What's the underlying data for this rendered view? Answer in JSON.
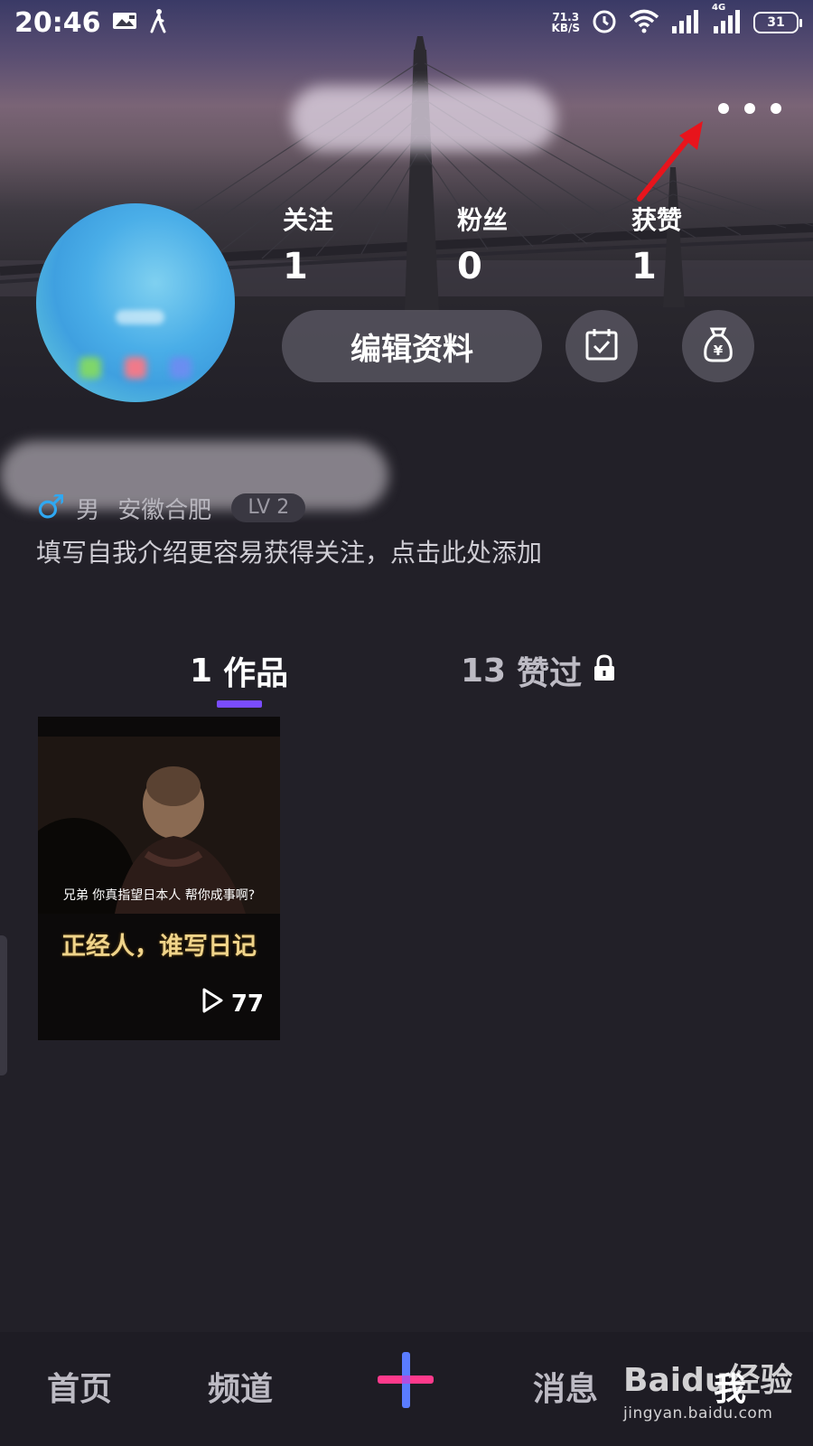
{
  "status_bar": {
    "time": "20:46",
    "net_speed_value": "71.3",
    "net_speed_unit": "KB/S",
    "network_type": "4G",
    "battery": "31"
  },
  "profile": {
    "stats": [
      {
        "label": "关注",
        "value": "1"
      },
      {
        "label": "粉丝",
        "value": "0"
      },
      {
        "label": "获赞",
        "value": "1"
      }
    ],
    "edit_button": "编辑资料",
    "gender_symbol": "♂",
    "gender": "男",
    "location": "安徽合肥",
    "level": "LV 2",
    "bio_placeholder": "填写自我介绍更容易获得关注，点击此处添加"
  },
  "tabs": {
    "works_count": "1",
    "works_label": "作品",
    "likes_count": "13",
    "likes_label": "赞过"
  },
  "video": {
    "subtitle": "兄弟  你真指望日本人  帮你成事啊?",
    "caption": "正经人，谁写日记",
    "play_count": "77"
  },
  "bottom_nav": {
    "home": "首页",
    "channel": "频道",
    "messages": "消息",
    "me": "我"
  },
  "watermark": {
    "brand": "Baidu经验",
    "url": "jingyan.baidu.com"
  },
  "colors": {
    "background": "#222028",
    "tab_accent": "#7a4cff",
    "gender_blue": "#2fa8f2",
    "annotation_arrow": "#e8141c"
  },
  "icons": [
    "walk-icon",
    "alarm-icon",
    "wifi-icon",
    "signal-icon",
    "more-icon",
    "calendar-check-icon",
    "money-bag-icon",
    "male-icon",
    "lock-icon",
    "play-icon",
    "plus-icon"
  ]
}
